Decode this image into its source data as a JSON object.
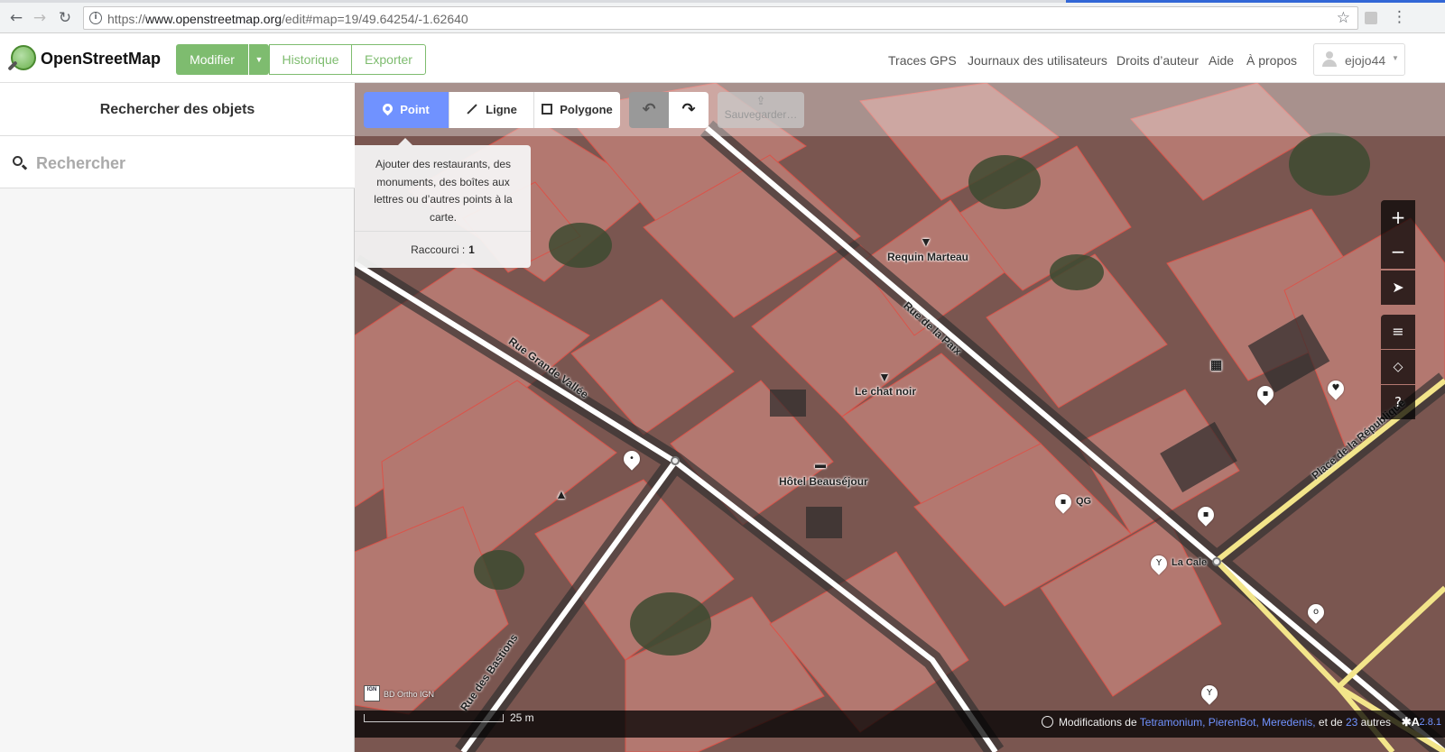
{
  "browser": {
    "url_scheme": "https://",
    "url_host": "www.openstreetmap.org",
    "url_path": "/edit#map=19/49.64254/-1.62640",
    "back_icon": "back-arrow-icon",
    "forward_icon": "forward-arrow-icon",
    "reload_icon": "reload-icon",
    "star_icon": "star-icon",
    "menu_icon": "kebab-menu-icon"
  },
  "header": {
    "brand": "OpenStreetMap",
    "edit_label": "Modifier",
    "history_label": "Historique",
    "export_label": "Exporter",
    "links": [
      "Traces GPS",
      "Journaux des utilisateurs",
      "Droits d’auteur",
      "Aide",
      "À propos"
    ],
    "username": "ejojo44",
    "accent_color": "#7ebc6f"
  },
  "sidebar": {
    "title": "Rechercher des objets",
    "search_placeholder": "Rechercher"
  },
  "editor": {
    "modes": {
      "point": "Point",
      "line": "Ligne",
      "area": "Polygone"
    },
    "save_label": "Sauvegarder…",
    "tooltip": {
      "text": "Ajouter des restaurants, des monuments, des boîtes aux lettres ou d’autres points à la carte.",
      "shortcut_label": "Raccourci :",
      "shortcut_key": "1"
    },
    "active_color": "#7092ff"
  },
  "map": {
    "places": {
      "bar1": "Requin Marteau",
      "bar2": "Le chat noir",
      "hotel": "Hôtel Beauséjour",
      "shop": "QG",
      "restaurant": "La Cale"
    },
    "streets": {
      "s1": "Rue Grande Vallée",
      "s2": "Rue de la Paix",
      "s3": "Rue des Bastions",
      "s4": "Place de la République"
    },
    "imagery_label": "BD Ortho IGN",
    "ign_logo": "IGN"
  },
  "footer": {
    "scale": "25 m",
    "attribution_prefix": "Modifications de",
    "contributors": "Tetramonium, PierenBot, Meredenis,",
    "attribution_mid": "et de",
    "others_count": "23",
    "attribution_suffix": "autres",
    "version": "2.8.1"
  }
}
